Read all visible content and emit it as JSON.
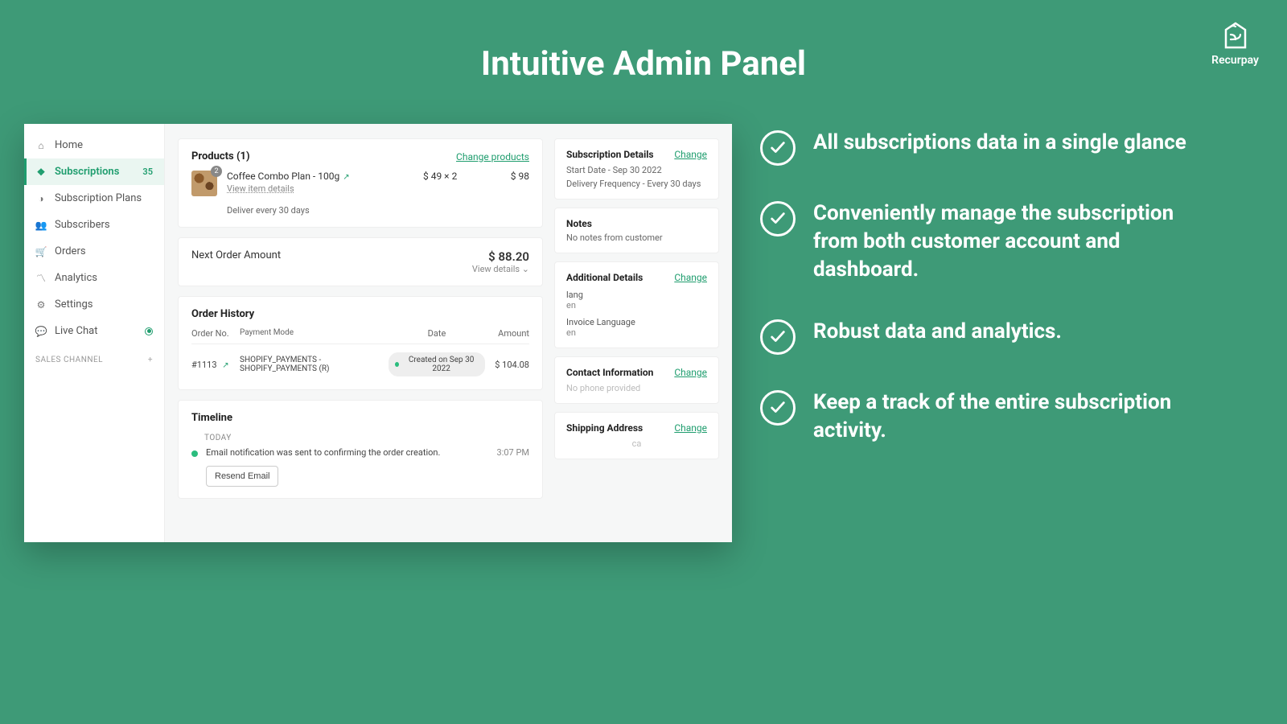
{
  "page": {
    "title": "Intuitive Admin Panel"
  },
  "brand": {
    "name": "Recurpay"
  },
  "sidebar": {
    "items": [
      {
        "label": "Home"
      },
      {
        "label": "Subscriptions",
        "badge": "35"
      },
      {
        "label": "Subscription Plans"
      },
      {
        "label": "Subscribers"
      },
      {
        "label": "Orders"
      },
      {
        "label": "Analytics"
      },
      {
        "label": "Settings"
      },
      {
        "label": "Live Chat"
      }
    ],
    "section": "SALES CHANNEL"
  },
  "products": {
    "heading": "Products (1)",
    "change": "Change products",
    "item": {
      "name": "Coffee Combo Plan - 100g",
      "view_details": "View item details",
      "delivery": "Deliver every 30 days",
      "price": "$ 49 × 2",
      "total": "$ 98",
      "qty": "2"
    }
  },
  "next_order": {
    "label": "Next Order Amount",
    "amount": "$ 88.20",
    "view": "View details ⌄"
  },
  "order_history": {
    "heading": "Order History",
    "cols": {
      "num": "Order No.",
      "mode": "Payment Mode",
      "date": "Date",
      "amount": "Amount"
    },
    "row": {
      "num": "#1113",
      "mode": "SHOPIFY_PAYMENTS - SHOPIFY_PAYMENTS (R)",
      "date": "Created on Sep 30 2022",
      "amount": "$ 104.08"
    }
  },
  "timeline": {
    "heading": "Timeline",
    "day": "TODAY",
    "entry": "Email notification was sent to                       confirming the order creation.",
    "time": "3:07 PM",
    "resend": "Resend Email"
  },
  "right": {
    "sub_details": {
      "title": "Subscription Details",
      "change": "Change",
      "start": "Start Date - Sep 30 2022",
      "freq": "Delivery Frequency - Every 30 days"
    },
    "notes": {
      "title": "Notes",
      "text": "No notes from customer"
    },
    "additional": {
      "title": "Additional Details",
      "change": "Change",
      "k1": "lang",
      "v1": "en",
      "k2": "Invoice Language",
      "v2": "en"
    },
    "contact": {
      "title": "Contact Information",
      "change": "Change",
      "text": "No phone provided"
    },
    "shipping": {
      "title": "Shipping Address",
      "change": "Change",
      "text": "ca"
    }
  },
  "features": [
    "All subscriptions data in a single glance",
    "Conveniently manage the subscription from both customer account and dashboard.",
    "Robust data and analytics.",
    "Keep a track of the entire subscription activity."
  ]
}
